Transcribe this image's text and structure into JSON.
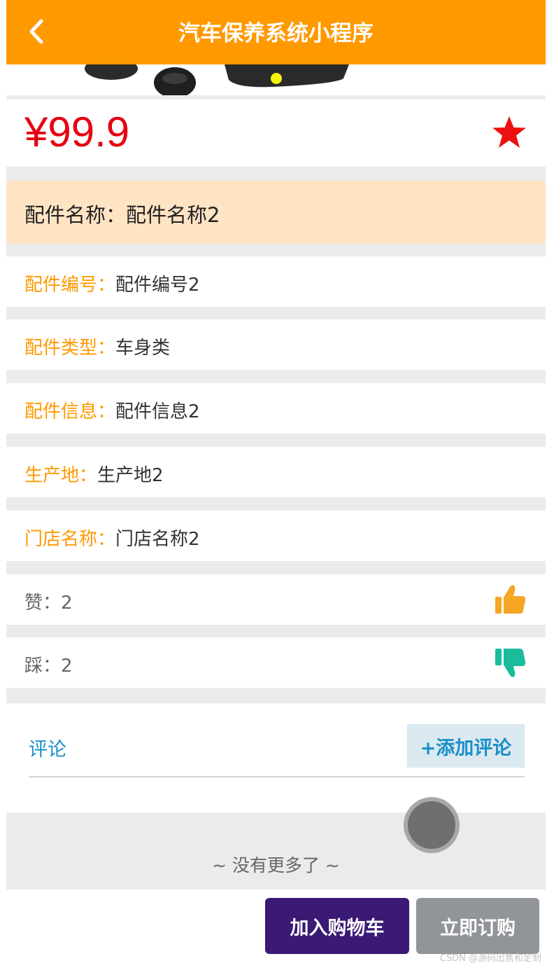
{
  "header": {
    "title": "汽车保养系统小程序"
  },
  "product": {
    "price": "¥99.9",
    "name_label": "配件名称：",
    "name_value": "配件名称2"
  },
  "details": [
    {
      "label": "配件编号：",
      "value": "配件编号2"
    },
    {
      "label": "配件类型：",
      "value": "车身类"
    },
    {
      "label": "配件信息：",
      "value": "配件信息2"
    },
    {
      "label": "生产地：",
      "value": "生产地2"
    },
    {
      "label": "门店名称：",
      "value": "门店名称2"
    }
  ],
  "votes": {
    "like_label": "赞：",
    "like_count": "2",
    "dislike_label": "踩：",
    "dislike_count": "2"
  },
  "comments": {
    "label": "评论",
    "add_button": "+添加评论"
  },
  "footer": {
    "no_more": "~ 没有更多了 ~",
    "add_to_cart": "加入购物车",
    "buy_now": "立即订购"
  },
  "watermark": "CSDN @源码出售和定制",
  "icons": {
    "back": "chevron-left-icon",
    "favorite": "star-icon",
    "like": "thumbs-up-icon",
    "dislike": "thumbs-down-icon"
  },
  "colors": {
    "header": "#ff9900",
    "price": "#e60012",
    "name_bg": "#ffe4c4",
    "detail_label": "#ff9900",
    "like": "#f5a623",
    "dislike": "#1abc9c",
    "comment_accent": "#1a8fc9",
    "cart_button": "#3a1a75",
    "buy_button": "#919498"
  }
}
